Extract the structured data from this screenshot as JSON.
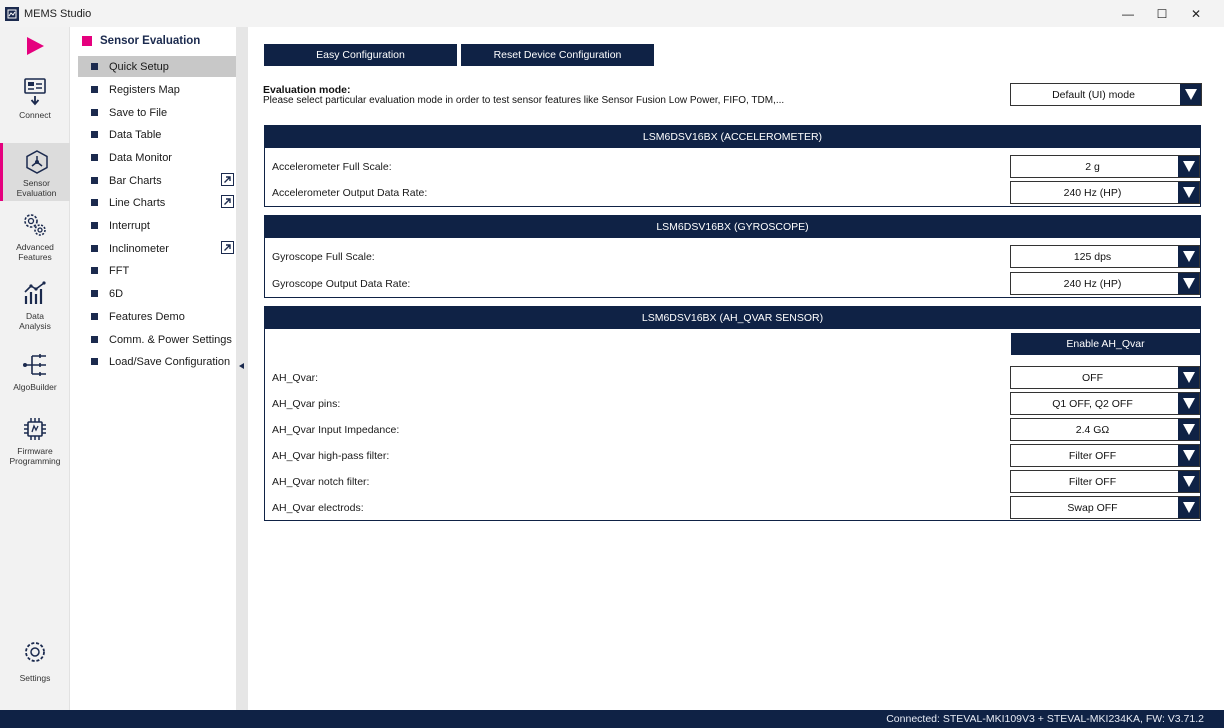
{
  "window": {
    "title": "MEMS Studio",
    "minimize": "—",
    "maximize": "☐",
    "close": "✕"
  },
  "rail": {
    "items": [
      {
        "label": "Connect"
      },
      {
        "label": "Sensor Evaluation"
      },
      {
        "label": "Advanced Features"
      },
      {
        "label": "Data Analysis"
      },
      {
        "label": "AlgoBuilder"
      },
      {
        "label": "Firmware Programming"
      },
      {
        "label": "Settings"
      }
    ]
  },
  "menu": {
    "header": "Sensor Evaluation",
    "items": [
      {
        "label": "Quick Setup"
      },
      {
        "label": "Registers Map"
      },
      {
        "label": "Save to File"
      },
      {
        "label": "Data Table"
      },
      {
        "label": "Data Monitor"
      },
      {
        "label": "Bar Charts"
      },
      {
        "label": "Line Charts"
      },
      {
        "label": "Interrupt"
      },
      {
        "label": "Inclinometer"
      },
      {
        "label": "FFT"
      },
      {
        "label": "6D"
      },
      {
        "label": "Features Demo"
      },
      {
        "label": "Comm. & Power Settings"
      },
      {
        "label": "Load/Save Configuration"
      }
    ]
  },
  "toolbar": {
    "easy_config": "Easy Configuration",
    "reset_config": "Reset Device Configuration"
  },
  "evaluation": {
    "title": "Evaluation mode:",
    "description": "Please select particular evaluation mode in order to test sensor features like Sensor Fusion Low Power, FIFO, TDM,...",
    "mode": "Default (UI) mode"
  },
  "accel": {
    "title": "LSM6DSV16BX (ACCELEROMETER)",
    "full_scale_label": "Accelerometer Full Scale:",
    "full_scale_value": "2 g",
    "odr_label": "Accelerometer Output Data Rate:",
    "odr_value": "240 Hz (HP)"
  },
  "gyro": {
    "title": "LSM6DSV16BX (GYROSCOPE)",
    "full_scale_label": "Gyroscope Full Scale:",
    "full_scale_value": "125 dps",
    "odr_label": "Gyroscope Output Data Rate:",
    "odr_value": "240 Hz (HP)"
  },
  "qvar": {
    "title": "LSM6DSV16BX (AH_QVAR SENSOR)",
    "enable_label": "Enable AH_Qvar",
    "rows": [
      {
        "label": "AH_Qvar:",
        "value": "OFF"
      },
      {
        "label": "AH_Qvar pins:",
        "value": "Q1 OFF, Q2 OFF"
      },
      {
        "label": "AH_Qvar Input Impedance:",
        "value": "2.4 GΩ"
      },
      {
        "label": "AH_Qvar high-pass filter:",
        "value": "Filter OFF"
      },
      {
        "label": "AH_Qvar notch filter:",
        "value": "Filter OFF"
      },
      {
        "label": "AH_Qvar electrods:",
        "value": "Swap OFF"
      }
    ]
  },
  "status": {
    "text": "Connected:  STEVAL-MKI109V3 + STEVAL-MKI234KA, FW: V3.71.2"
  },
  "colors": {
    "navy": "#0f2245",
    "accent": "#e5007e"
  }
}
